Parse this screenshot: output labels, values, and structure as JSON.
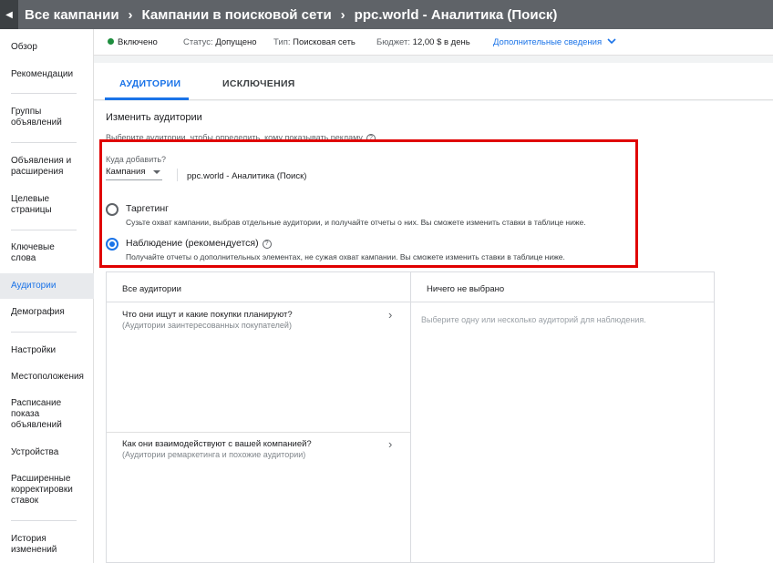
{
  "breadcrumbs": [
    "Все кампании",
    "Кампании в поисковой сети",
    "ppc.world - Аналитика (Поиск)"
  ],
  "sidebar": {
    "items": [
      {
        "label": "Обзор"
      },
      {
        "label": "Рекомендации"
      },
      {
        "label": "Группы объявлений"
      },
      {
        "label": "Объявления и расширения"
      },
      {
        "label": "Целевые страницы"
      },
      {
        "label": "Ключевые слова"
      },
      {
        "label": "Аудитории",
        "active": true
      },
      {
        "label": "Демография"
      },
      {
        "label": "Настройки"
      },
      {
        "label": "Местоположения"
      },
      {
        "label": "Расписание показа объявлений"
      },
      {
        "label": "Устройства"
      },
      {
        "label": "Расширенные корректировки ставок"
      },
      {
        "label": "История изменений"
      }
    ]
  },
  "status": {
    "state": "Включено",
    "status_label": "Статус:",
    "status_value": "Допущено",
    "type_label": "Тип:",
    "type_value": "Поисковая сеть",
    "budget_label": "Бюджет:",
    "budget_value": "12,00 $ в день",
    "more_details": "Дополнительные сведения"
  },
  "tabs": [
    {
      "label": "АУДИТОРИИ",
      "active": true
    },
    {
      "label": "ИСКЛЮЧЕНИЯ",
      "active": false
    }
  ],
  "section": {
    "title": "Изменить аудитории",
    "subtitle": "Выберите аудитории, чтобы определить, кому показывать рекламу"
  },
  "add_to": {
    "label": "Куда добавить?",
    "selected": "Кампания",
    "campaign_name": "ppc.world - Аналитика (Поиск)"
  },
  "options": {
    "targeting": {
      "title": "Таргетинг",
      "desc": "Сузьте охват кампании, выбрав отдельные аудитории, и получайте отчеты о них. Вы сможете изменить ставки в таблице ниже.",
      "checked": false
    },
    "observation": {
      "title": "Наблюдение (рекомендуется)",
      "desc": "Получайте отчеты о дополнительных элементах, не сужая охват кампании. Вы сможете изменить ставки в таблице ниже.",
      "checked": true
    }
  },
  "lists": {
    "left_header": "Все аудитории",
    "right_header": "Ничего не выбрано",
    "categories": [
      {
        "title": "Что они ищут и какие покупки планируют?",
        "sub": "(Аудитории заинтересованных покупателей)"
      },
      {
        "title": "Как они взаимодействуют с вашей компанией?",
        "sub": "(Аудитории ремаркетинга и похожие аудитории)"
      }
    ],
    "empty_note": "Выберите одну или несколько аудиторий для наблюдения."
  },
  "colors": {
    "accent": "#1a73e8",
    "highlight": "#e00000",
    "enabled": "#1e8e3e"
  },
  "icons": {
    "back": "chevron-left-icon",
    "crumb_sep": "chevron-right-icon",
    "help": "help-circle-icon",
    "expand": "chevron-down-icon"
  }
}
